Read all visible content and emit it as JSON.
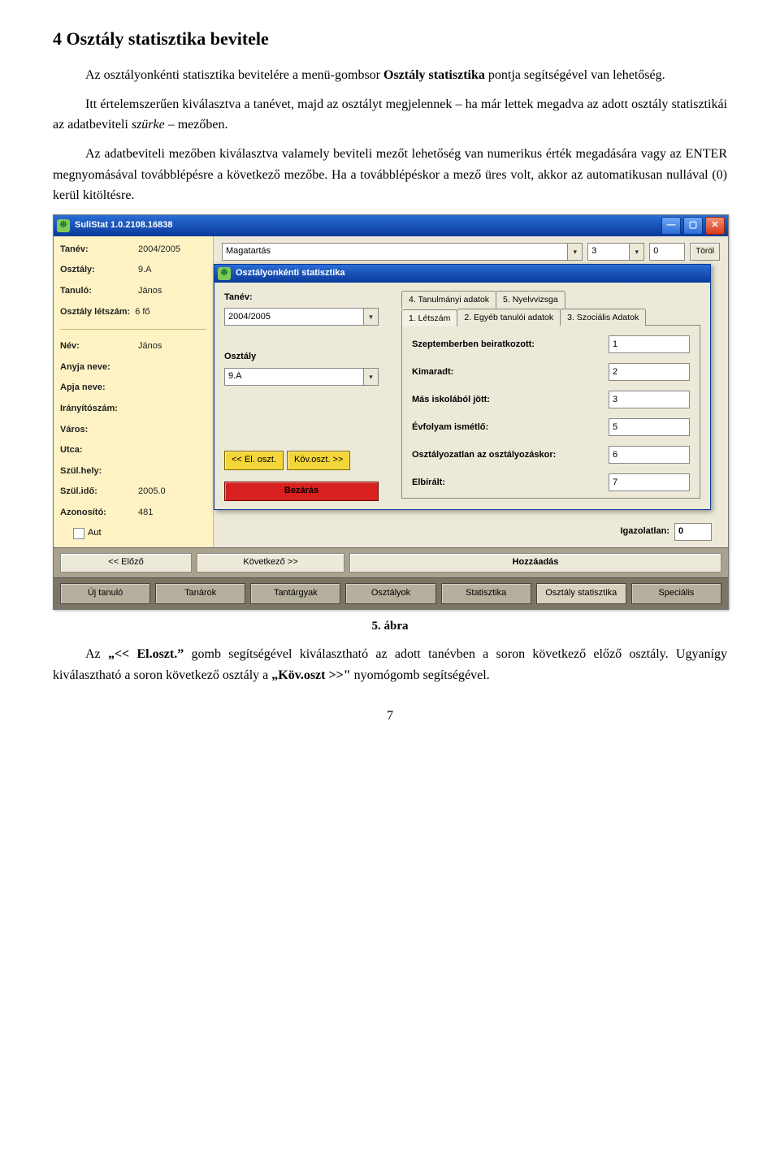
{
  "heading": "4  Osztály statisztika bevitele",
  "para1_a": "Az osztályonkénti statisztika bevitelére a menü-gombsor ",
  "para1_b": "Osztály statisztika",
  "para1_c": " pontja segítségével van lehetőség.",
  "para2_a": "Itt értelemszerűen kiválasztva a tanévet, majd az osztályt megjelennek – ha már lettek megadva az adott osztály statisztikái az adatbeviteli ",
  "para2_b": "szürke",
  "para2_c": " – mezőben.",
  "para3": "Az adatbeviteli mezőben kiválasztva valamely beviteli mezőt lehetőség van numerikus érték megadására vagy az ENTER megnyomásával továbblépésre a következő mezőbe. Ha a továbblépéskor a mező üres volt, akkor az automatikusan nullával (0) kerül kitöltésre.",
  "caption": "5. ábra",
  "para4_a": "Az ",
  "para4_b": "„<< El.oszt.”",
  "para4_c": " gomb segítségével kiválasztható az adott tanévben a soron következő előző osztály. Ugyanígy kiválasztható a soron következő osztály a ",
  "para4_d": "„Köv.oszt >>\"",
  "para4_e": " nyomógomb segítségével.",
  "pagenum": "7",
  "app": {
    "title": "SuliStat 1.0.2108.16838",
    "left": {
      "tanev_label": "Tanév:",
      "tanev_value": "2004/2005",
      "osztaly_label": "Osztály:",
      "osztaly_value": "9.A",
      "tanulo_label": "Tanuló:",
      "tanulo_value": "János",
      "letszam_label": "Osztály létszám:",
      "letszam_value": "6 fő",
      "nev_label": "Név:",
      "nev_value": "János",
      "anyja_label": "Anyja neve:",
      "apja_label": "Apja neve:",
      "irszam_label": "Irányítószám:",
      "varos_label": "Város:",
      "utca_label": "Utca:",
      "szulhely_label": "Szül.hely:",
      "szulido_label": "Szül.idő:",
      "szulido_value": "2005.0",
      "azon_label": "Azonosító:",
      "azon_value": "481",
      "auto_label": "Aut"
    },
    "top": {
      "magatartas": "Magatartás",
      "val1": "3",
      "val2": "0",
      "torol": "Töröl"
    },
    "modal": {
      "title": "Osztályonkénti statisztika",
      "tanev_label": "Tanév:",
      "tanev_value": "2004/2005",
      "osztaly_label": "Osztály",
      "osztaly_value": "9.A",
      "el_oszt": "<< El. oszt.",
      "kov_oszt": "Köv.oszt. >>",
      "bezaras": "Bezárás",
      "tabs_row1": [
        "4. Tanulmányi adatok",
        "5. Nyelvvizsga"
      ],
      "tabs_row2": [
        "1. Létszám",
        "2. Egyéb tanulói adatok",
        "3. Szociális Adatok"
      ],
      "fields": [
        {
          "label": "Szeptemberben beiratkozott:",
          "value": "1"
        },
        {
          "label": "Kimaradt:",
          "value": "2"
        },
        {
          "label": "Más iskolából jött:",
          "value": "3"
        },
        {
          "label": "Évfolyam ismétlő:",
          "value": "5"
        },
        {
          "label": "Osztályozatlan az osztályozáskor:",
          "value": "6"
        },
        {
          "label": "Elbírált:",
          "value": "7"
        }
      ]
    },
    "igazolatlan_label": "Igazolatlan:",
    "igazolatlan_value": "0",
    "nav": {
      "elozo": "<< Előző",
      "kovetkezo": "Következő >>",
      "hozzaadas": "Hozzáadás"
    },
    "bottom": [
      "Új tanuló",
      "Tanárok",
      "Tantárgyak",
      "Osztályok",
      "Statisztika",
      "Osztály statisztika",
      "Speciális"
    ]
  }
}
